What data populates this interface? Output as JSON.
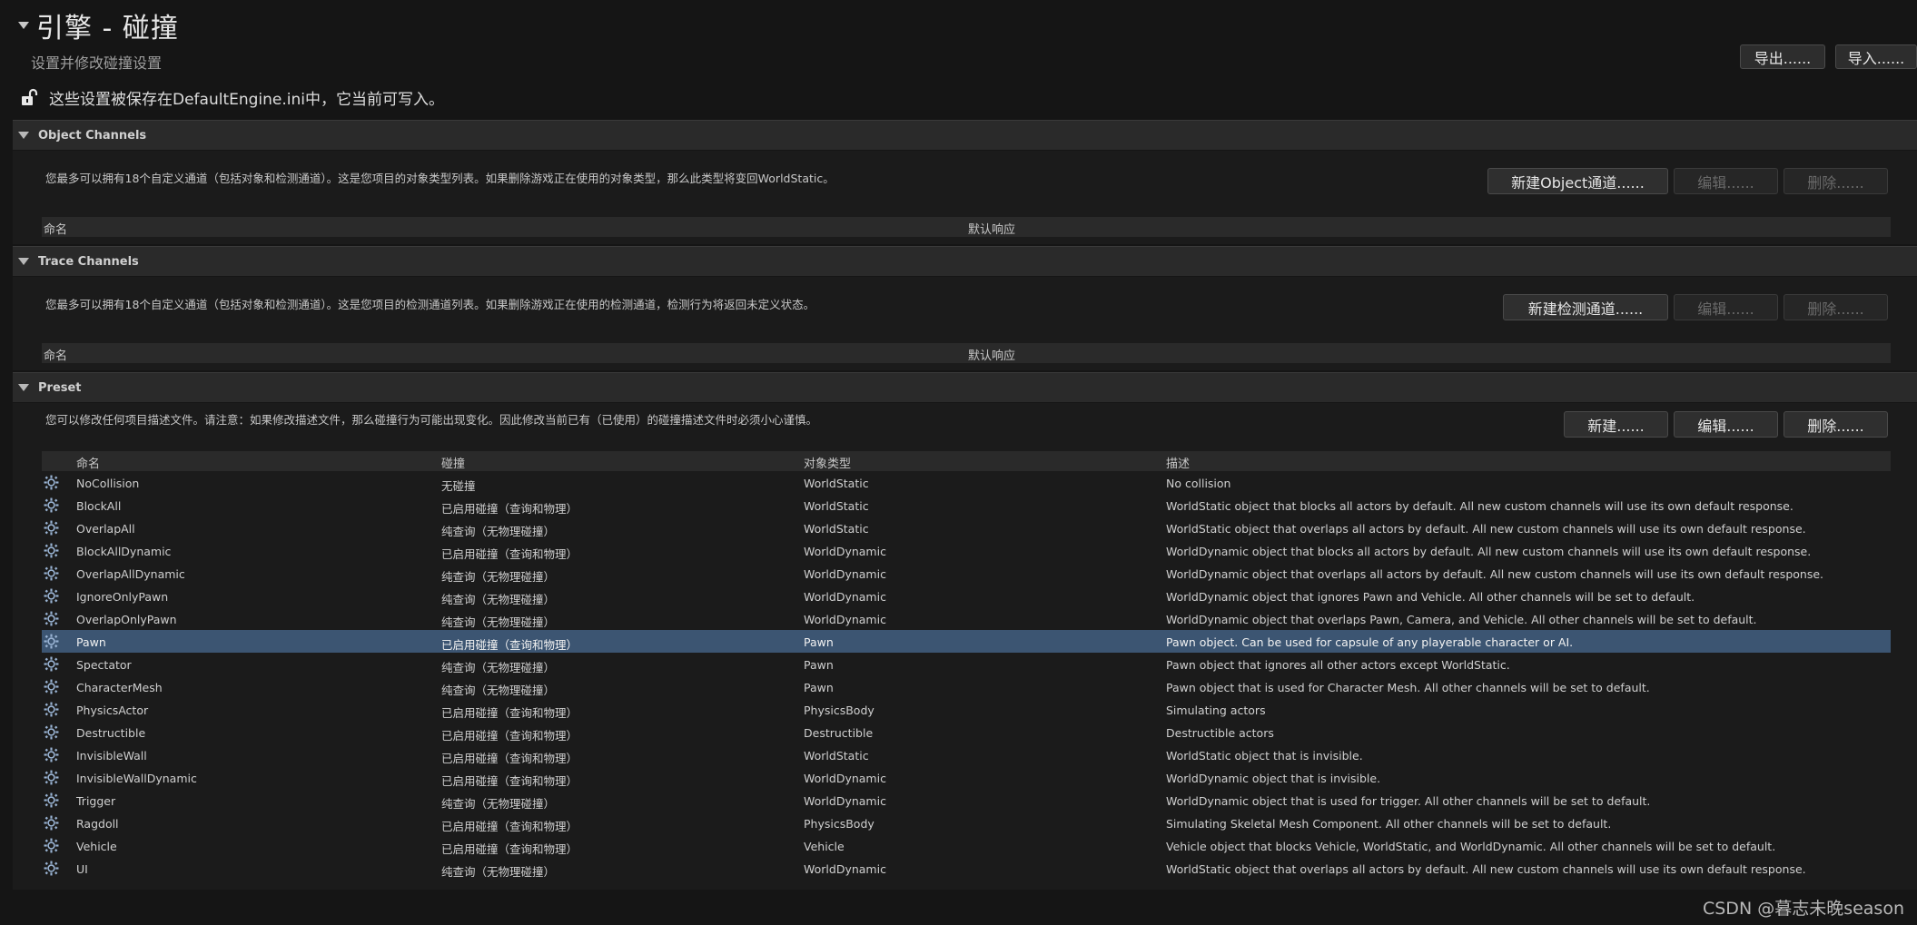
{
  "header": {
    "title": "引擎 - 碰撞",
    "subtitle": "设置并修改碰撞设置",
    "notice": "这些设置被保存在DefaultEngine.ini中，它当前可写入。",
    "export_label": "导出......",
    "import_label": "导入......"
  },
  "object_channels": {
    "title": "Object Channels",
    "description": "您最多可以拥有18个自定义通道（包括对象和检测通道）。这是您项目的对象类型列表。如果删除游戏正在使用的对象类型，那么此类型将变回WorldStatic。",
    "new_label": "新建Object通道......",
    "edit_label": "编辑......",
    "delete_label": "删除......",
    "columns": [
      "命名",
      "默认响应"
    ]
  },
  "trace_channels": {
    "title": "Trace Channels",
    "description": "您最多可以拥有18个自定义通道（包括对象和检测通道）。这是您项目的检测通道列表。如果删除游戏正在使用的检测通道，检测行为将返回未定义状态。",
    "new_label": "新建检测通道......",
    "edit_label": "编辑......",
    "delete_label": "删除......",
    "columns": [
      "命名",
      "默认响应"
    ]
  },
  "preset": {
    "title": "Preset",
    "description": "您可以修改任何项目描述文件。请注意：如果修改描述文件，那么碰撞行为可能出现变化。因此修改当前已有（已使用）的碰撞描述文件时必须小心谨慎。",
    "new_label": "新建......",
    "edit_label": "编辑......",
    "delete_label": "删除......",
    "columns": [
      "命名",
      "碰撞",
      "对象类型",
      "描述"
    ],
    "selected_index": 7,
    "rows": [
      [
        "NoCollision",
        "无碰撞",
        "WorldStatic",
        "No collision"
      ],
      [
        "BlockAll",
        "已启用碰撞（查询和物理）",
        "WorldStatic",
        "WorldStatic object that blocks all actors by default. All new custom channels will use its own default response."
      ],
      [
        "OverlapAll",
        "纯查询（无物理碰撞）",
        "WorldStatic",
        "WorldStatic object that overlaps all actors by default. All new custom channels will use its own default response."
      ],
      [
        "BlockAllDynamic",
        "已启用碰撞（查询和物理）",
        "WorldDynamic",
        "WorldDynamic object that blocks all actors by default. All new custom channels will use its own default response."
      ],
      [
        "OverlapAllDynamic",
        "纯查询（无物理碰撞）",
        "WorldDynamic",
        "WorldDynamic object that overlaps all actors by default. All new custom channels will use its own default response."
      ],
      [
        "IgnoreOnlyPawn",
        "纯查询（无物理碰撞）",
        "WorldDynamic",
        "WorldDynamic object that ignores Pawn and Vehicle. All other channels will be set to default."
      ],
      [
        "OverlapOnlyPawn",
        "纯查询（无物理碰撞）",
        "WorldDynamic",
        "WorldDynamic object that overlaps Pawn, Camera, and Vehicle. All other channels will be set to default."
      ],
      [
        "Pawn",
        "已启用碰撞（查询和物理）",
        "Pawn",
        "Pawn object. Can be used for capsule of any playerable character or AI."
      ],
      [
        "Spectator",
        "纯查询（无物理碰撞）",
        "Pawn",
        "Pawn object that ignores all other actors except WorldStatic."
      ],
      [
        "CharacterMesh",
        "纯查询（无物理碰撞）",
        "Pawn",
        "Pawn object that is used for Character Mesh. All other channels will be set to default."
      ],
      [
        "PhysicsActor",
        "已启用碰撞（查询和物理）",
        "PhysicsBody",
        "Simulating actors"
      ],
      [
        "Destructible",
        "已启用碰撞（查询和物理）",
        "Destructible",
        "Destructible actors"
      ],
      [
        "InvisibleWall",
        "已启用碰撞（查询和物理）",
        "WorldStatic",
        "WorldStatic object that is invisible."
      ],
      [
        "InvisibleWallDynamic",
        "已启用碰撞（查询和物理）",
        "WorldDynamic",
        "WorldDynamic object that is invisible."
      ],
      [
        "Trigger",
        "纯查询（无物理碰撞）",
        "WorldDynamic",
        "WorldDynamic object that is used for trigger. All other channels will be set to default."
      ],
      [
        "Ragdoll",
        "已启用碰撞（查询和物理）",
        "PhysicsBody",
        "Simulating Skeletal Mesh Component. All other channels will be set to default."
      ],
      [
        "Vehicle",
        "已启用碰撞（查询和物理）",
        "Vehicle",
        "Vehicle object that blocks Vehicle, WorldStatic, and WorldDynamic. All other channels will be set to default."
      ],
      [
        "UI",
        "纯查询（无物理碰撞）",
        "WorldDynamic",
        "WorldStatic object that overlaps all actors by default. All new custom channels will use its own default response."
      ]
    ]
  },
  "watermark": "CSDN @暮志未晚season",
  "colors": {
    "background": "#151515",
    "section_header": "#2a2a2a",
    "selected_row": "#3c5572"
  }
}
